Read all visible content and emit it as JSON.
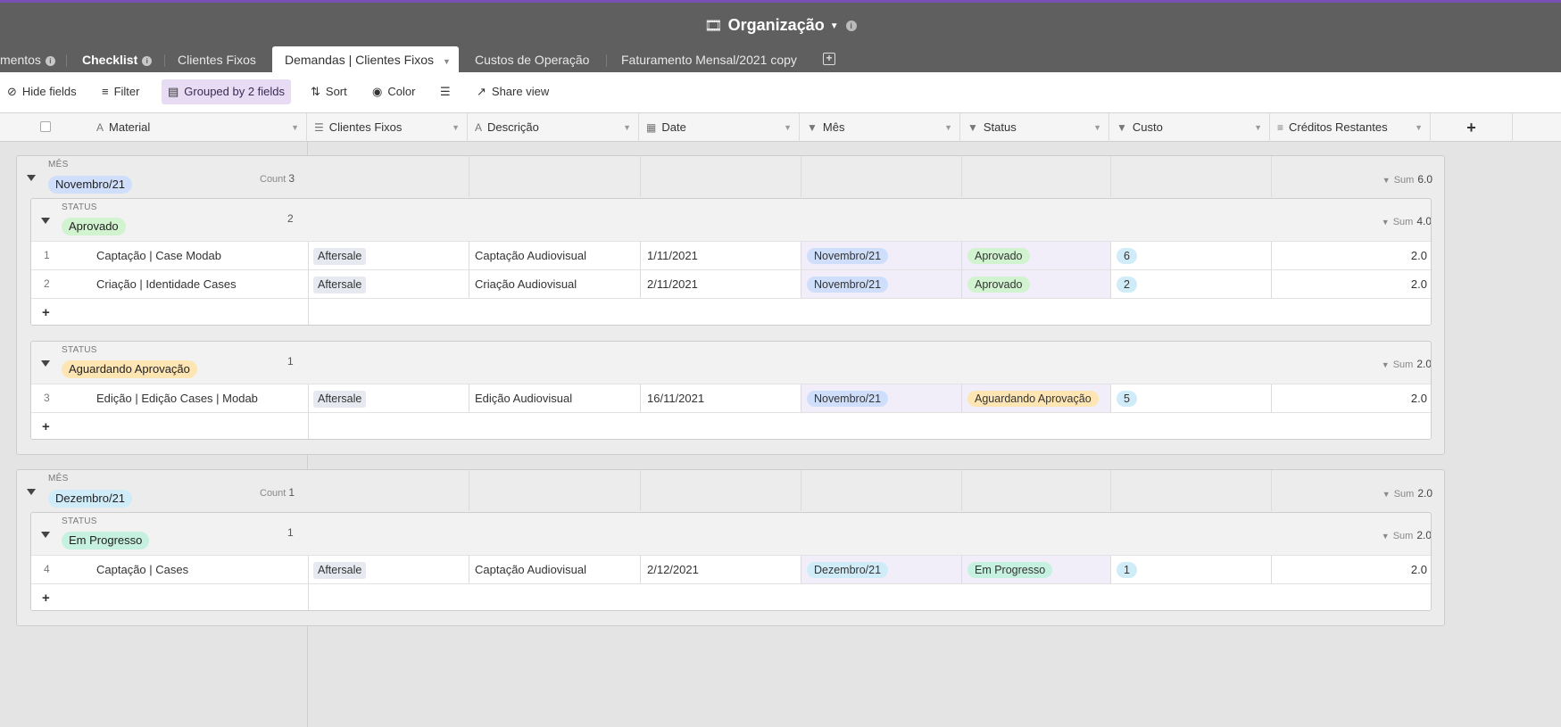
{
  "header": {
    "title": "Organização"
  },
  "tabs": [
    {
      "label": "mentos",
      "info": true
    },
    {
      "label": "Checklist",
      "info": true
    },
    {
      "label": "Clientes Fixos"
    },
    {
      "label": "Demandas | Clientes Fixos",
      "active": true
    },
    {
      "label": "Custos de Operação"
    },
    {
      "label": "Faturamento Mensal/2021 copy"
    }
  ],
  "toolbar": {
    "hide_fields": "Hide fields",
    "filter": "Filter",
    "grouped": "Grouped by 2 fields",
    "sort": "Sort",
    "color": "Color",
    "share": "Share view"
  },
  "columns": [
    "Material",
    "Clientes Fixos",
    "Descrição",
    "Date",
    "Mês",
    "Status",
    "Custo",
    "Créditos Restantes"
  ],
  "colors": {
    "accent": "#7a4fb5",
    "mes_novembro": "#cfdffb",
    "mes_dezembro": "#d0ecf8",
    "aprovado": "#d1f3cf",
    "aguardando": "#fde6b4",
    "em_progresso": "#c6f0e0",
    "custo": "#d0ecf8"
  },
  "groups": {
    "g1": {
      "label": "MÊS",
      "value": "Novembro/21",
      "count_label": "Count",
      "count": "3",
      "sum_label": "Sum",
      "sum": "6.0",
      "sub1": {
        "label": "STATUS",
        "value": "Aprovado",
        "count": "2",
        "sum_label": "Sum",
        "sum": "4.0"
      },
      "sub2": {
        "label": "STATUS",
        "value": "Aguardando Aprovação",
        "count": "1",
        "sum_label": "Sum",
        "sum": "2.0"
      }
    },
    "g2": {
      "label": "MÊS",
      "value": "Dezembro/21",
      "count_label": "Count",
      "count": "1",
      "sum_label": "Sum",
      "sum": "2.0",
      "sub1": {
        "label": "STATUS",
        "value": "Em Progresso",
        "count": "1",
        "sum_label": "Sum",
        "sum": "2.0"
      }
    }
  },
  "rows": [
    {
      "n": "1",
      "material": "Captação | Case Modab",
      "cliente": "Aftersale",
      "descricao": "Captação Audiovisual",
      "date": "1/11/2021",
      "mes": "Novembro/21",
      "status": "Aprovado",
      "custo": "6",
      "creditos": "2.0"
    },
    {
      "n": "2",
      "material": "Criação | Identidade Cases",
      "cliente": "Aftersale",
      "descricao": "Criação Audiovisual",
      "date": "2/11/2021",
      "mes": "Novembro/21",
      "status": "Aprovado",
      "custo": "2",
      "creditos": "2.0"
    },
    {
      "n": "3",
      "material": "Edição | Edição Cases | Modab",
      "cliente": "Aftersale",
      "descricao": "Edição Audiovisual",
      "date": "16/11/2021",
      "mes": "Novembro/21",
      "status": "Aguardando Aprovação",
      "custo": "5",
      "creditos": "2.0"
    },
    {
      "n": "4",
      "material": "Captação | Cases",
      "cliente": "Aftersale",
      "descricao": "Captação Audiovisual",
      "date": "2/12/2021",
      "mes": "Dezembro/21",
      "status": "Em Progresso",
      "custo": "1",
      "creditos": "2.0"
    }
  ],
  "add_row": "+"
}
